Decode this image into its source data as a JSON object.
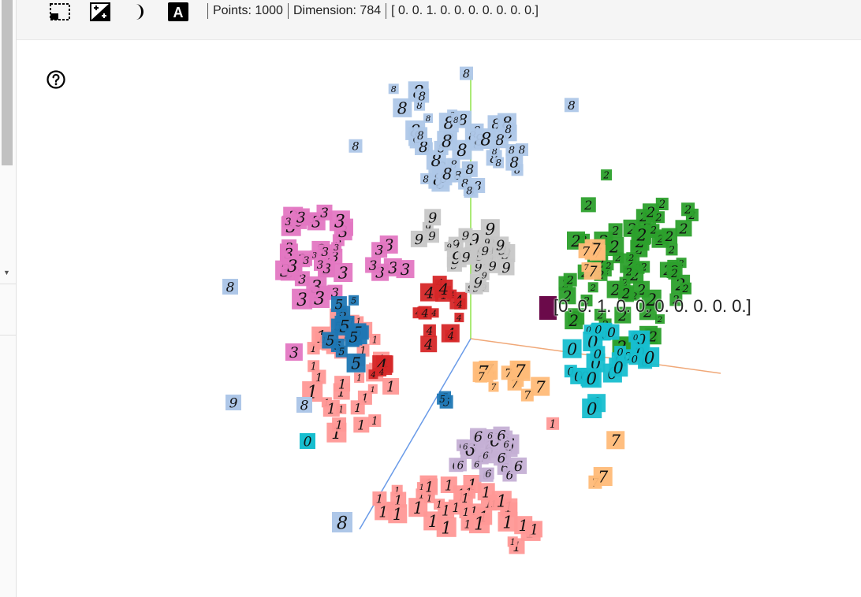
{
  "toolbar": {
    "icons": [
      "select-box-icon",
      "night-mode-toggle-icon",
      "moon-icon",
      "label-toggle-icon"
    ],
    "label_icon_text": "A",
    "points_label": "Points: 1000",
    "dimension_label": "Dimension: 784",
    "selected_vector": "[ 0. 0. 1. 0. 0. 0. 0. 0. 0. 0.]"
  },
  "projection": {
    "tooltip": "[0. 0. 1. 0. 0. 0. 0. 0. 0. 0.]",
    "clusters": [
      {
        "digit": "8",
        "color": "#aec7e8"
      },
      {
        "digit": "3",
        "color": "#e377c2"
      },
      {
        "digit": "2",
        "color": "#2ca02c"
      },
      {
        "digit": "1",
        "color": "#ff9896"
      },
      {
        "digit": "5",
        "color": "#1f77b4"
      },
      {
        "digit": "4",
        "color": "#d62728"
      },
      {
        "digit": "9",
        "color": "#c7c7c7"
      },
      {
        "digit": "0",
        "color": "#17becf"
      },
      {
        "digit": "7",
        "color": "#ffbb78"
      },
      {
        "digit": "6",
        "color": "#c5b0d5"
      }
    ]
  }
}
